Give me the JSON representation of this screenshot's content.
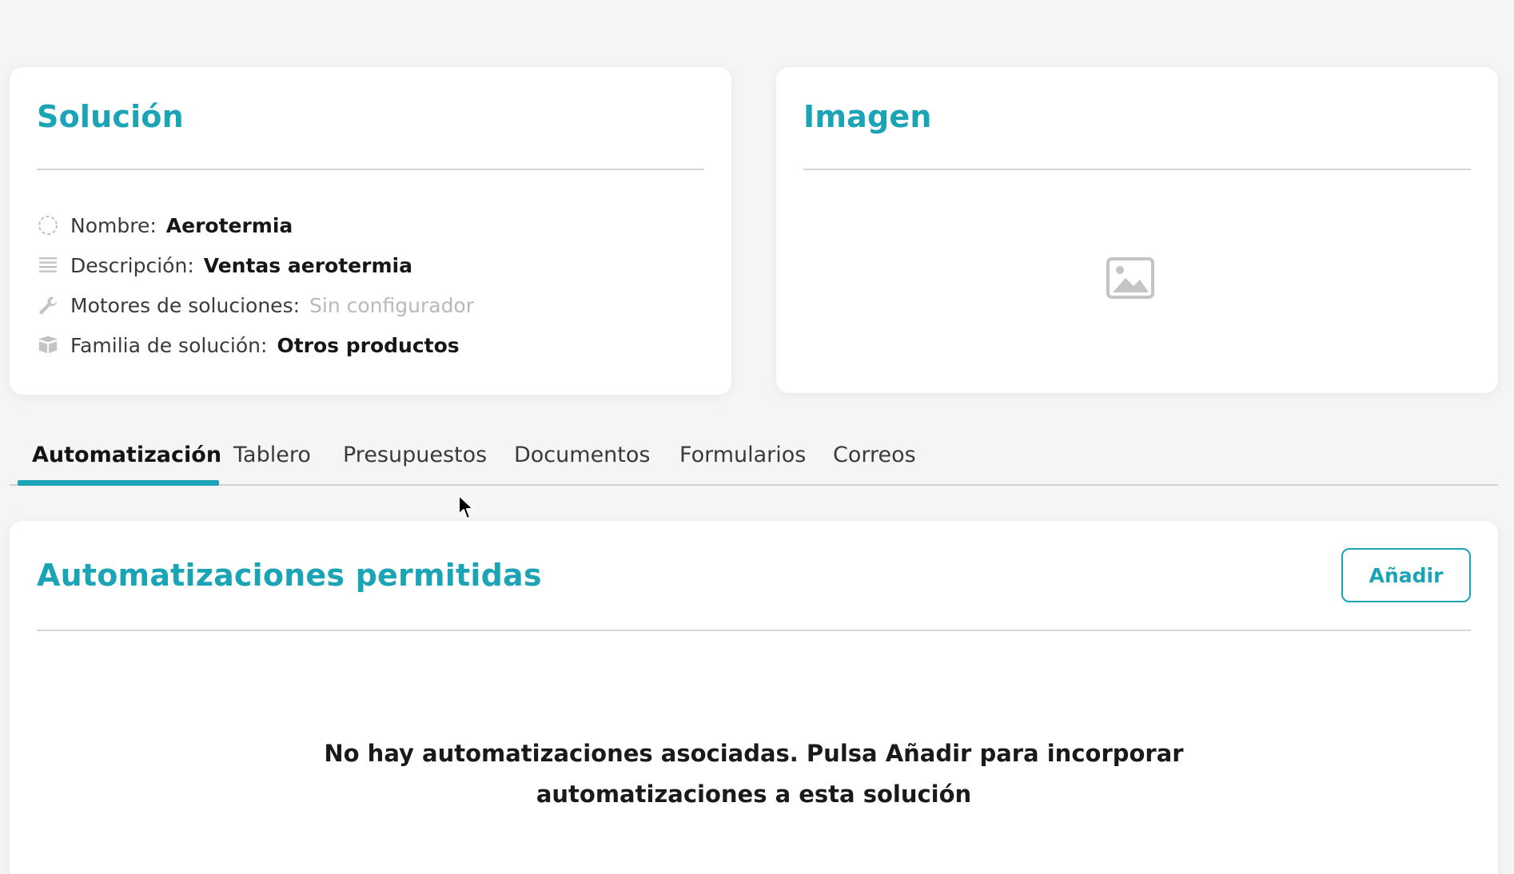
{
  "solution_card": {
    "title": "Solución",
    "fields": [
      {
        "icon": "loading-circle-icon",
        "label": "Nombre:",
        "value": "Aerotermia"
      },
      {
        "icon": "lines-icon",
        "label": "Descripción:",
        "value": "Ventas aerotermia"
      },
      {
        "icon": "wrench-icon",
        "label": "Motores de soluciones:",
        "value": "Sin configurador"
      },
      {
        "icon": "box-icon",
        "label": "Familia de solución:",
        "value": "Otros productos"
      }
    ]
  },
  "image_card": {
    "title": "Imagen",
    "placeholder_icon": "image-placeholder-icon"
  },
  "tabs": [
    {
      "label": "Automatización",
      "active": true
    },
    {
      "label": "Tablero"
    },
    {
      "label": "Presupuestos"
    },
    {
      "label": "Documentos"
    },
    {
      "label": "Formularios"
    },
    {
      "label": "Correos"
    }
  ],
  "automations_card": {
    "title": "Automatizaciones permitidas",
    "add_label": "Añadir",
    "empty_message_line1": "No hay automatizaciones asociadas. Pulsa Añadir para incorporar",
    "empty_message_line2": "automatizaciones a esta solución"
  },
  "colors": {
    "accent": "#1ba3b6",
    "background": "#f5f5f5",
    "muted_text": "#b9b9b9"
  }
}
